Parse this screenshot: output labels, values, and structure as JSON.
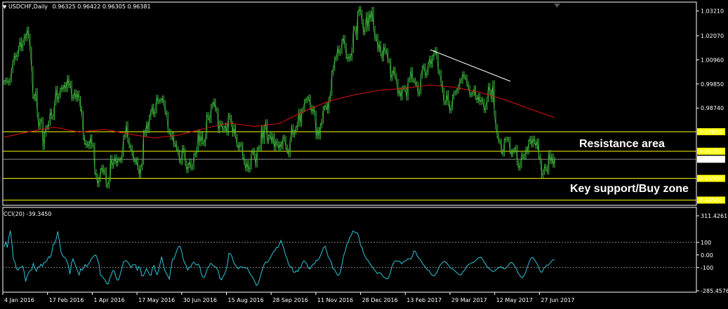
{
  "header": {
    "symbol": "USDCHF,Daily",
    "ohlc": "0.96325 0.96422 0.96305 0.96381"
  },
  "indicator": {
    "label": "CCI(20) -39.3450"
  },
  "annotations": {
    "resistance": "Resistance area",
    "support": "Key support/Buy zone"
  },
  "colors": {
    "background": "#000000",
    "candles": "#3fbf3f",
    "ma": "#e01010",
    "levels": "#ffff00",
    "cci": "#2fc4d9",
    "price_line": "#8a8a8a"
  },
  "chart_data": [
    {
      "type": "line",
      "title": "USDCHF,Daily",
      "price_scale": {
        "range": [
          0.9426,
          1.0362
        ],
        "ticks": [
          "1.03210",
          "1.02070",
          "1.00960",
          "0.99850",
          "0.98740"
        ]
      },
      "x_labels": [
        "4 Jan 2016",
        "17 Feb 2016",
        "1 Apr 2016",
        "17 May 2016",
        "30 Jun 2016",
        "15 Aug 2016",
        "28 Sep 2016",
        "11 Nov 2016",
        "28 Dec 2016",
        "13 Feb 2017",
        "29 Mar 2017",
        "12 May 2017",
        "27 Jun 2017"
      ],
      "levels": [
        {
          "value": 0.9765,
          "label": "0.97650"
        },
        {
          "value": 0.9675,
          "label": "0.96750"
        },
        {
          "value": 0.955,
          "label": "0.95500"
        },
        {
          "value": 0.945,
          "label": "0.94500"
        }
      ],
      "current_price": {
        "value": 0.96381,
        "label": "0.96381"
      },
      "series": [
        {
          "values": [
            0.9992,
            1.0003,
            0.9997,
            0.999,
            1.0002,
            1.0046,
            1.0083,
            1.0117,
            1.0104,
            1.0122,
            1.0149,
            1.0187,
            1.0147,
            1.0174,
            1.0205,
            1.0194,
            1.0237,
            1.0205,
            1.0146,
            1.0055,
            0.9927,
            0.9918,
            0.9954,
            0.9844,
            0.9785,
            0.9814,
            0.982,
            0.9693,
            0.9752,
            0.9784,
            0.9784,
            0.9804,
            0.986,
            0.9833,
            0.983,
            0.9896,
            0.9964,
            0.991,
            0.993,
            0.9957,
            0.9969,
            0.996,
            0.9982,
            0.9959,
            1.0014,
            0.9977,
            0.9988,
            0.9918,
            0.9926,
            0.9948,
            0.9916,
            0.9943,
            0.9918,
            0.9872,
            0.9848,
            0.974,
            0.9716,
            0.9702,
            0.9711,
            0.9696,
            0.9741,
            0.9701,
            0.9703,
            0.9581,
            0.956,
            0.9522,
            0.9545,
            0.9585,
            0.9601,
            0.9578,
            0.9589,
            0.9519,
            0.9515,
            0.9547,
            0.9646,
            0.9606,
            0.9627,
            0.9648,
            0.9617,
            0.9636,
            0.9635,
            0.9632,
            0.966,
            0.974,
            0.9748,
            0.9801,
            0.9727,
            0.97,
            0.9692,
            0.9666,
            0.9636,
            0.9625,
            0.9636,
            0.9599,
            0.9564,
            0.9599,
            0.9624,
            0.9762,
            0.9755,
            0.98,
            0.977,
            0.9831,
            0.9855,
            0.9882,
            0.9844,
            0.986,
            0.9923,
            0.9904,
            0.9907,
            0.9909,
            0.992,
            0.9898,
            0.9854,
            0.9846,
            0.9768,
            0.9764,
            0.9739,
            0.9752,
            0.9706,
            0.9712,
            0.9686,
            0.9671,
            0.9631,
            0.9624,
            0.9692,
            0.9677,
            0.9621,
            0.9587,
            0.9609,
            0.9629,
            0.9598,
            0.9602,
            0.9658,
            0.9658,
            0.9682,
            0.9763,
            0.971,
            0.9751,
            0.9716,
            0.9709,
            0.9742,
            0.9843,
            0.9829,
            0.9816,
            0.9882,
            0.989,
            0.9906,
            0.9869,
            0.9862,
            0.977,
            0.9805,
            0.98,
            0.9773,
            0.978,
            0.9795,
            0.9759,
            0.984,
            0.9831,
            0.9801,
            0.9754,
            0.9787,
            0.9744,
            0.9705,
            0.969,
            0.9707,
            0.9706,
            0.9652,
            0.9625,
            0.9594,
            0.9623,
            0.9589,
            0.9601,
            0.9669,
            0.9679,
            0.9653,
            0.9612,
            0.9684,
            0.969,
            0.9689,
            0.9782,
            0.972,
            0.9785,
            0.981,
            0.9721,
            0.9741,
            0.9753,
            0.9721,
            0.9747,
            0.969,
            0.9721,
            0.971,
            0.9686,
            0.9709,
            0.9694,
            0.9739,
            0.9734,
            0.9694,
            0.9675,
            0.9659,
            0.9729,
            0.9787,
            0.975,
            0.9762,
            0.978,
            0.9799,
            0.9859,
            0.98,
            0.9861,
            0.9867,
            0.9906,
            0.991,
            0.9917,
            0.9924,
            0.9877,
            0.9856,
            0.9872,
            0.985,
            0.9742,
            0.9775,
            0.9741,
            0.9792,
            0.9812,
            0.9874,
            0.9877,
            0.9887,
            0.986,
            0.9913,
            0.9941,
            1.0035,
            1.0057,
            1.01,
            1.0105,
            1.015,
            1.0127,
            1.0135,
            1.018,
            1.0199,
            1.0162,
            1.0112,
            1.0098,
            1.0112,
            1.0102,
            1.0139,
            1.0241,
            1.0239,
            1.0199,
            1.0308,
            1.0332,
            1.0315,
            1.0273,
            1.0221,
            1.0235,
            1.0305,
            1.024,
            1.0311,
            1.0283,
            1.0328,
            1.0241,
            1.0194,
            1.0204,
            1.0143,
            1.0171,
            1.0126,
            1.01,
            1.0159,
            1.0133,
            1.0138,
            1.0092,
            1.0092,
            1.001,
            1.0033,
            1.0053,
            1.0021,
            0.9996,
            0.9939,
            0.9957,
            0.9921,
            0.9965,
            0.9968,
            0.9961,
            0.9921,
            1.0002,
            1.0004,
            1.005,
            1.0002,
            1.0002,
            0.9987,
            0.9984,
            0.9939,
            0.9949,
            1.0021,
            1.006,
            1.0068,
            1.0024,
            1.0036,
            1.0072,
            1.0103,
            1.0071,
            1.0107,
            1.0129,
            1.0143,
            1.0112,
            1.0042,
            1.0038,
            0.9988,
            0.9957,
            0.9899,
            0.99,
            0.9944,
            0.9897,
            0.9862,
            0.9875,
            0.9925,
            0.9943,
            0.9946,
            0.9953,
            0.9969,
            1.0,
            0.9998,
            1.0031,
            1.0018,
            1.0016,
            0.9985,
            0.9968,
            0.9935,
            0.9937,
            0.9942,
            0.9966,
            0.9924,
            0.9908,
            0.9931,
            0.99,
            0.9913,
            0.9905,
            0.9863,
            0.9877,
            0.9913,
            0.9978,
            0.9949,
            0.9912,
            0.999,
            0.9852,
            0.979,
            0.9748,
            0.9723,
            0.972,
            0.9673,
            0.9663,
            0.9725,
            0.973,
            0.973,
            0.973,
            0.9674,
            0.966,
            0.9676,
            0.9681,
            0.9692,
            0.9622,
            0.9598,
            0.9609,
            0.9658,
            0.965,
            0.9647,
            0.9685,
            0.9672,
            0.9719,
            0.9734,
            0.9704,
            0.9735,
            0.9717,
            0.9696,
            0.9723,
            0.9652,
            0.9629,
            0.9564,
            0.9577,
            0.9605,
            0.9594,
            0.958,
            0.9669,
            0.9628,
            0.9653,
            0.9611,
            0.9638
          ]
        },
        {
          "values": [
            0.974,
            0.9765,
            0.9786,
            0.9763,
            0.9776,
            0.9754,
            0.9736,
            0.975,
            0.978,
            0.9805,
            0.979,
            0.9803,
            0.986,
            0.9907,
            0.9935,
            0.9956,
            0.9965,
            0.998,
            0.997,
            0.9947,
            0.9913,
            0.987,
            0.983
          ]
        },
        {
          "values": [
            64,
            103,
            59,
            138,
            193,
            96,
            -34,
            -59,
            -110,
            -122,
            -102,
            -101,
            -88,
            -132,
            -211,
            -166,
            -141,
            -123,
            -121,
            -68,
            -104,
            -129,
            -100,
            -96,
            -74,
            -90,
            -62,
            -58,
            -43,
            -14,
            -21,
            10,
            85,
            89,
            127,
            187,
            117,
            33,
            -3,
            -16,
            -24,
            -52,
            -86,
            -153,
            -67,
            -31,
            -66,
            -95,
            -128,
            -160,
            -110,
            -122,
            -102,
            -76,
            -93,
            -73,
            -57,
            -30,
            -18,
            -4,
            -2,
            -33,
            -73,
            -162,
            -169,
            -188,
            -200,
            -227,
            -232,
            -185,
            -160,
            -126,
            -126,
            -176,
            -202,
            -193,
            -150,
            -104,
            -56,
            -47,
            -46,
            -60,
            -81,
            -101,
            -78,
            -77,
            -79,
            -122,
            -93,
            -104,
            -167,
            -166,
            -141,
            -110,
            -130,
            -158,
            -162,
            -103,
            -85,
            -131,
            -157,
            -122,
            -68,
            -13,
            -75,
            -123,
            -145,
            -167,
            -193,
            -109,
            -33,
            -32,
            2,
            40,
            65,
            70,
            34,
            -30,
            -64,
            -84,
            -121,
            -100,
            -94,
            -69,
            -56,
            -74,
            -80,
            -73,
            -98,
            -155,
            -179,
            -178,
            -144,
            -104,
            -90,
            -67,
            -76,
            -88,
            -93,
            -107,
            -126,
            -183,
            -198,
            -175,
            -154,
            -125,
            -74,
            13,
            9,
            -14,
            -58,
            -80,
            -91,
            -111,
            -99,
            -93,
            -102,
            -97,
            -106,
            -106,
            -128,
            -155,
            -170,
            -189,
            -217,
            -243,
            -231,
            -194,
            -150,
            -111,
            -77,
            -57,
            -60,
            -45,
            -23,
            -1,
            25,
            32,
            60,
            59,
            85,
            115,
            82,
            46,
            -2,
            -28,
            -76,
            -94,
            -97,
            -134,
            -140,
            -125,
            -133,
            -107,
            -99,
            -64,
            -46,
            -58,
            -74,
            -105,
            -112,
            -91,
            -73,
            -73,
            -42,
            -43,
            -28,
            -1,
            31,
            62,
            68,
            23,
            -18,
            -37,
            -58,
            -110,
            -114,
            -139,
            -162,
            -158,
            -135,
            -71,
            -6,
            27,
            80,
            102,
            141,
            156,
            191,
            184,
            175,
            176,
            143,
            78,
            61,
            13,
            -11,
            -34,
            -44,
            -66,
            -84,
            -97,
            -117,
            -131,
            -148,
            -141,
            -143,
            -156,
            -176,
            -181,
            -189,
            -189,
            -165,
            -120,
            -79,
            -56,
            -47,
            -48,
            -51,
            -54,
            -71,
            -55,
            -51,
            -43,
            -31,
            -31,
            -33,
            -9,
            32,
            28,
            -5,
            -23,
            -34,
            -55,
            -77,
            -89,
            -107,
            -119,
            -124,
            -149,
            -162,
            -168,
            -155,
            -138,
            -109,
            -83,
            -69,
            -57,
            -52,
            -59,
            -74,
            -91,
            -105,
            -110,
            -117,
            -129,
            -141,
            -151,
            -159,
            -157,
            -133,
            -124,
            -99,
            -83,
            -75,
            -68,
            -61,
            -61,
            -49,
            -37,
            -25,
            -20,
            -19,
            -38,
            -57,
            -78,
            -96,
            -109,
            -117,
            -127,
            -134,
            -126,
            -115,
            -104,
            -98,
            -94,
            -104,
            -112,
            -106,
            -94,
            -78,
            -64,
            -59,
            -72,
            -93,
            -110,
            -141,
            -160,
            -175,
            -181,
            -164,
            -141,
            -103,
            -68,
            -38,
            -20,
            -22,
            -41,
            -60,
            -80,
            -114,
            -137,
            -135,
            -104,
            -95,
            -81,
            -81,
            -65,
            -50,
            -39,
            -39
          ]
        }
      ]
    },
    {
      "type": "line",
      "title": "CCI(20) -39.3450",
      "y_range": [
        -285.4576,
        311.4261
      ],
      "ticks": [
        "311.4261",
        "100",
        "0.00",
        "-100",
        "-285.4576"
      ],
      "levels": [
        100,
        -100
      ]
    }
  ]
}
